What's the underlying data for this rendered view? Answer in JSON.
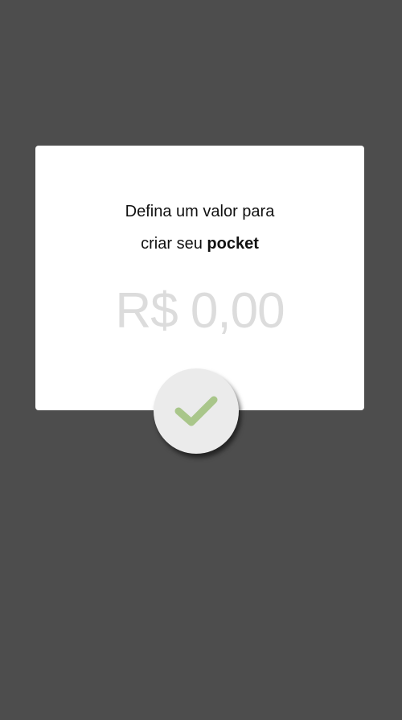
{
  "dialog": {
    "prompt_line1": "Defina um valor para",
    "prompt_line2_prefix": "criar seu ",
    "prompt_line2_bold": "pocket",
    "amount_placeholder": "R$ 0,00"
  },
  "confirm_button": {
    "icon": "check-icon",
    "icon_color": "#a9c68a"
  },
  "colors": {
    "overlay": "#4d4d4d",
    "dialog_bg": "#ffffff",
    "placeholder": "#dcdcdc",
    "button_bg": "#ebebeb"
  }
}
